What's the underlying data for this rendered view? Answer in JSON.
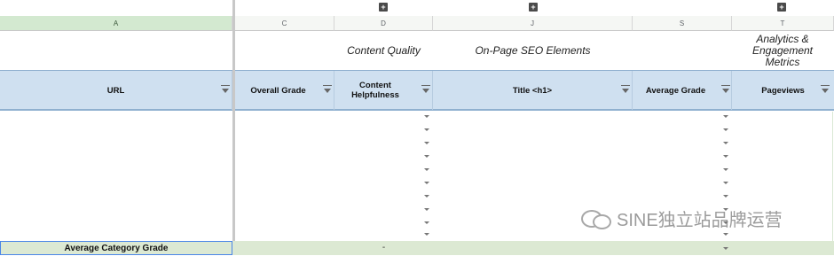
{
  "columns": {
    "A": "A",
    "C": "C",
    "D": "D",
    "J": "J",
    "S": "S",
    "T": "T"
  },
  "group_toggle_symbol": "+",
  "categories": {
    "content_quality": "Content Quality",
    "on_page_seo": "On-Page SEO Elements",
    "analytics": "Analytics & Engagement Metrics"
  },
  "headers": {
    "url": "URL",
    "overall_grade": "Overall Grade",
    "content_helpfulness": "Content Helpfulness",
    "title_h1": "Title <h1>",
    "average_grade": "Average Grade",
    "pageviews": "Pageviews"
  },
  "footer": {
    "label": "Average Category Grade",
    "value_d": "-",
    "value_s": "-"
  },
  "watermark": "SINE独立站品牌运营",
  "colors": {
    "header_bg": "#cfe0f0",
    "footer_bg": "#dce9d3",
    "selected_col": "#d3e9d0"
  }
}
